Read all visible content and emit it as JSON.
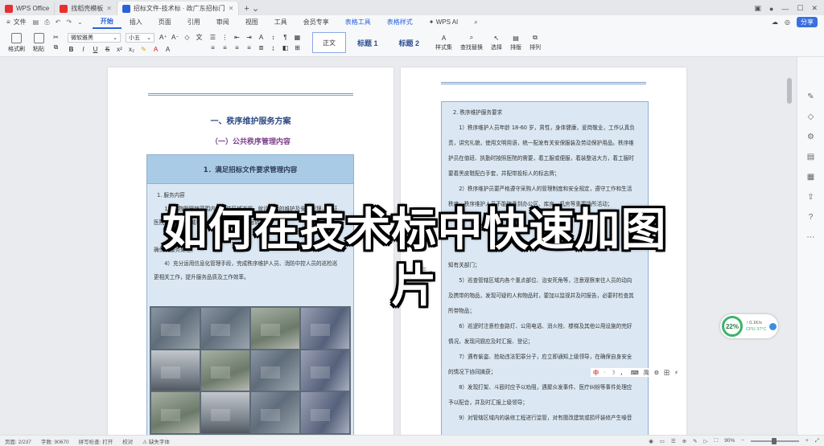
{
  "tabs": [
    {
      "label": "WPS Office",
      "icon": "wps-logo-icon",
      "color": "#e5302d"
    },
    {
      "label": "找稻壳模板",
      "icon": "docer-icon",
      "color": "#e5302d"
    },
    {
      "label": "招标文件-技术标 · 政广东招标门",
      "icon": "word-doc-icon",
      "color": "#2a62d9",
      "active": true
    }
  ],
  "menu": {
    "file": "文件",
    "items": [
      "开始",
      "插入",
      "页面",
      "引用",
      "审阅",
      "视图",
      "工具",
      "会员专享"
    ],
    "active": "开始",
    "context_items": [
      "表格工具",
      "表格样式"
    ],
    "ai": "WPS AI",
    "share": "分享"
  },
  "ribbon": {
    "format_painter": "格式刷",
    "paste": "粘贴",
    "font_name": "微软雅黑",
    "font_size": "小五",
    "styles": {
      "normal": "正文",
      "heading1": "标题 1",
      "heading2": "标题 2"
    },
    "style_set": "样式集",
    "find_replace": "查找替换",
    "select": "选择",
    "sort": "排版",
    "arrange": "排列"
  },
  "page1": {
    "heading1": "一、秩序维护服务方案",
    "heading2": "（一）公共秩序管理内容",
    "box_title": "1．满足招标文件要求管理内容",
    "item": "1. 服务内容",
    "paragraphs": [
      "1）医院所管辖范围内的公共区域巡逻、就诊秩序的维护及安全管理，保证",
      "医院内、公共区域秩序良好及消防的正常运转，防",
      "确保…服务处理。",
      "4）充分运用信息化管理手段，完成秩序维护人员、消防中控人员的巡检巡",
      "更相关工作，提升服务品质及工作效率。"
    ]
  },
  "page2": {
    "title": "2. 秩序维护服务要求",
    "paragraphs": [
      "1）秩序维护人员年龄 18-60 岁，男性，身体健康，爱岗敬业，工作认真负",
      "责，讲究礼貌，使用文明用语，统一配发有关安保服装及劳动保护用品。秩序维",
      "护员在值班、执勤时按照医院的需要，着工服或便服，着装整洁大方，着工服时",
      "要着黑皮鞋配白手套，并配带投标人的标志牌；",
      "2）秩序维护员要严格遵守采购人的管理制度和安全规定，遵守工作和生活",
      "秩序，秩序维护人员不能随意到办公区、库房、机房等重要场所活动；",
      "知有关部门；",
      "5）巡查管辖区域内各个重点部位、治安死角等，注意观察来往人员的动向",
      "及携带的物品，发现可疑的人和物品时，要加以监视并及时报告，必要时检查其",
      "所带物品；",
      "6）巡逻时注意检查路灯、公用电话、消火栓、楼梯及其他公用设施的完好",
      "情况，发现问题应及时汇报、登记；",
      "7）遇有偷盗、抢劫违法犯罪分子，应立即通知上级领导，在确保自身安全",
      "的情况下协同擒获；",
      "8）发现打架、斗殴时应予以劝阻，遇聚众发事件、医疗纠纷等事件处理应",
      "予以配合，并及时汇报上级领导；",
      "9）对管辖区域内的装修工程进行监管，对有擅改建筑或损坏装修产生噪音"
    ]
  },
  "overlay_title": "如何在技术标中快速加图片",
  "perf": {
    "score": "22%",
    "net": "↑ 0.1K/s",
    "cpu": "CPU 37°C"
  },
  "ime": {
    "lang": "中",
    "items": [
      "·",
      "☽",
      "，",
      "⌨",
      "简",
      "⚙",
      "田",
      "⚡"
    ]
  },
  "status": {
    "page": "页面: 2/237",
    "words": "字数: 90670",
    "spell": "拼写检查: 打开",
    "proof": "校对",
    "missing_font": "缺失字体",
    "zoom": "90%"
  },
  "colors": {
    "accent": "#2a62d9",
    "heading": "#2d4a86",
    "subheading": "#7d3f8c",
    "table_fill": "#dbe8f4",
    "table_head": "#a9cbe6"
  }
}
